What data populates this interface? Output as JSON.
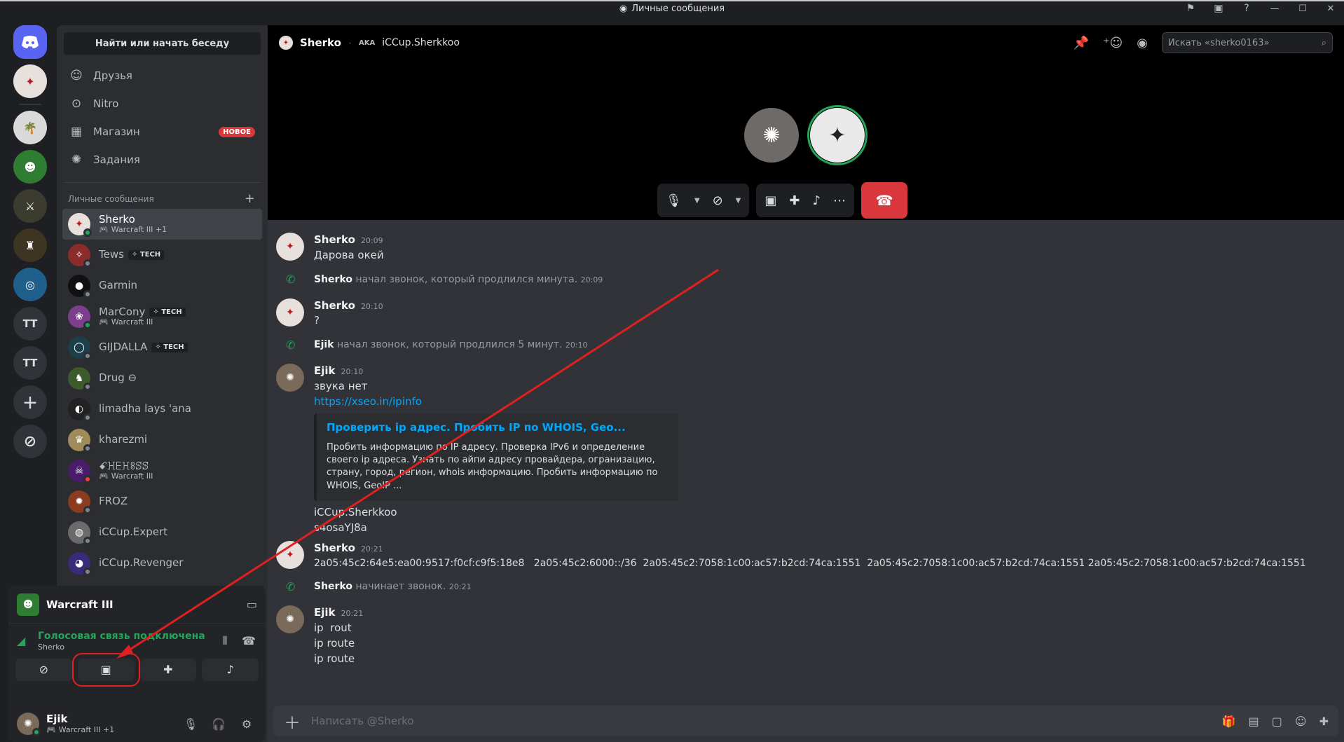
{
  "window": {
    "title": "Личные сообщения"
  },
  "rail": {
    "text_servers": [
      "TT",
      "TT"
    ]
  },
  "sidebar": {
    "find_button": "Найти или начать беседу",
    "nav": [
      {
        "label": "Друзья",
        "icon": "friends-icon"
      },
      {
        "label": "Nitro",
        "icon": "nitro-icon"
      },
      {
        "label": "Магазин",
        "icon": "shop-icon",
        "badge": "НОВОЕ"
      },
      {
        "label": "Задания",
        "icon": "quests-icon"
      }
    ],
    "dm_header": "Личные сообщения",
    "dms": [
      {
        "name": "Sherko",
        "sub": "Warcraft III +1",
        "status": "online",
        "active": true
      },
      {
        "name": "Tews",
        "tag": "TECH",
        "status": "offline"
      },
      {
        "name": "Garmin",
        "status": "offline"
      },
      {
        "name": "MarCony",
        "tag": "TECH",
        "sub": "Warcraft III",
        "status": "online"
      },
      {
        "name": "GIJDALLA",
        "tag": "TECH",
        "status": "offline"
      },
      {
        "name": "Drug ⊖",
        "status": "offline"
      },
      {
        "name": "limadha lays 'ana",
        "status": "offline"
      },
      {
        "name": "kharezmi",
        "status": "offline"
      },
      {
        "name": "ꗃꖾꗋꖾꗚꕷꕷ",
        "sub": "Warcraft III",
        "status": "dnd"
      },
      {
        "name": "FROZ",
        "status": "offline"
      },
      {
        "name": "iCCup.Expert",
        "status": "offline"
      },
      {
        "name": "iCCup.Revenger",
        "status": "offline"
      }
    ]
  },
  "panel": {
    "activity": "Warcraft III",
    "voice_status": "Голосовая связь подключена",
    "voice_channel": "Sherko",
    "user_name": "Ejik",
    "user_sub": "Warcraft III +1"
  },
  "header": {
    "name": "Sherko",
    "aka": "AKA",
    "alias": "iCCup.Sherkkoo",
    "search_placeholder": "Искать «sherko0163»"
  },
  "messages": [
    {
      "kind": "msg",
      "author": "Sherko",
      "time": "20:09",
      "lines": [
        "Дарова окей"
      ]
    },
    {
      "kind": "sys",
      "author": "Sherko",
      "text": "начал звонок, который продлился минута.",
      "time": "20:09"
    },
    {
      "kind": "msg",
      "author": "Sherko",
      "time": "20:10",
      "lines": [
        "?"
      ]
    },
    {
      "kind": "sys",
      "author": "Ejik",
      "text": "начал звонок, который продлился 5 минут.",
      "time": "20:10"
    },
    {
      "kind": "msg",
      "author": "Ejik",
      "time": "20:10",
      "lines": [
        "звука нет"
      ],
      "link": "https://xseo.in/ipinfo",
      "embed": {
        "title": "Проверить ip адрес. Пробить IP по WHOIS, Geo...",
        "desc": "Пробить информацию по IP адресу. Проверка IPv6 и определение своего ip адреса. Узнать по айпи адресу провайдера, огранизацию, страну, город, регион, whois информацию. Пробить информацию по WHOIS, GeoIP ..."
      },
      "after": [
        "iCCup.Sherkkoo",
        "s4osaYJ8a"
      ]
    },
    {
      "kind": "msg",
      "author": "Sherko",
      "time": "20:21",
      "lines": [
        "2a05:45c2:64e5:ea00:9517:f0cf:c9f5:18e8   2a05:45c2:6000::/36  2a05:45c2:7058:1c00:ac57:b2cd:74ca:1551  2a05:45c2:7058:1c00:ac57:b2cd:74ca:1551 2a05:45c2:7058:1c00:ac57:b2cd:74ca:1551"
      ]
    },
    {
      "kind": "sys",
      "author": "Sherko",
      "text": "начинает звонок.",
      "time": "20:21"
    },
    {
      "kind": "msg",
      "author": "Ejik",
      "time": "20:21",
      "lines": [
        "ip  rout",
        "ip route",
        "ip route"
      ]
    }
  ],
  "composer": {
    "placeholder": "Написать @Sherko"
  },
  "colors": {
    "accent": "#5865f2",
    "online": "#23a55a",
    "danger": "#da373c",
    "annotation": "#e02020"
  }
}
